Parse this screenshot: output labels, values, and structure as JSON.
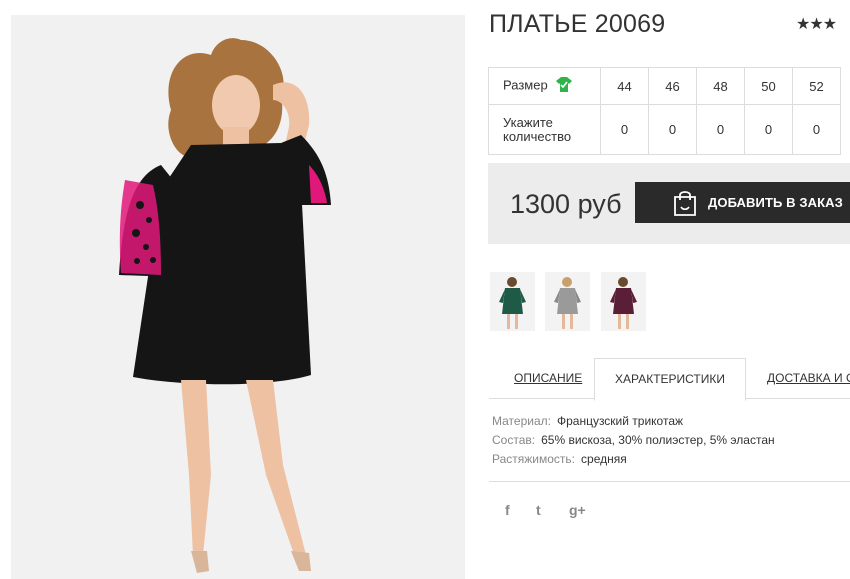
{
  "product": {
    "title": "ПЛАТЬЕ 20069",
    "rating_stars": "★★★"
  },
  "size_table": {
    "size_label": "Размер",
    "size_icon": "shirt-icon",
    "sizes": [
      "44",
      "46",
      "48",
      "50",
      "52"
    ],
    "qty_label_line1": "Укажите",
    "qty_label_line2": "количество",
    "quantities": [
      "0",
      "0",
      "0",
      "0",
      "0"
    ]
  },
  "purchase": {
    "price": "1300 руб",
    "add_button_label": "ДОБАВИТЬ В ЗАКАЗ",
    "add_button_icon": "shopping-bag-icon"
  },
  "thumbnails": [
    {
      "color": "#1f5a47",
      "name": "green"
    },
    {
      "color": "#9a9a9a",
      "name": "grey"
    },
    {
      "color": "#5a1f36",
      "name": "burgundy"
    }
  ],
  "tabs": [
    {
      "label": "ОПИСАНИЕ",
      "active": false
    },
    {
      "label": "ХАРАКТЕРИСТИКИ",
      "active": true
    },
    {
      "label": "ДОСТАВКА И ОП",
      "active": false
    }
  ],
  "specs": [
    {
      "key": "Материал:",
      "value": "Французский трикотаж"
    },
    {
      "key": "Состав:",
      "value": "65% вискоза, 30% полиэстер, 5% эластан"
    },
    {
      "key": "Растяжимость:",
      "value": "средняя"
    }
  ],
  "social": [
    {
      "glyph": "f",
      "icon": "facebook-icon"
    },
    {
      "glyph": "t",
      "icon": "twitter-icon"
    },
    {
      "glyph": "g+",
      "icon": "google-plus-icon"
    }
  ],
  "colors": {
    "accent_green": "#2fb34a",
    "button_bg": "#2a2a2a",
    "price_bg": "#ececec",
    "dress": "#151515",
    "dress_accent": "#e0187a"
  }
}
